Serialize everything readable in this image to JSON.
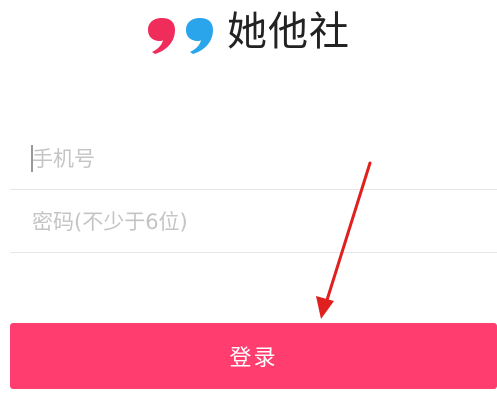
{
  "app": {
    "name": "她他社"
  },
  "login_form": {
    "phone_placeholder": "手机号",
    "password_placeholder": "密码(不少于6位)",
    "login_label": "登录"
  },
  "colors": {
    "logo_pink": "#f02c5a",
    "logo_blue": "#2aa4ea",
    "button_background": "#ff3d6f",
    "annotation_arrow": "#e01f1f"
  },
  "icons": {
    "logo": "quote-marks-logo-icon",
    "annotation": "red-arrow-annotation-icon"
  }
}
